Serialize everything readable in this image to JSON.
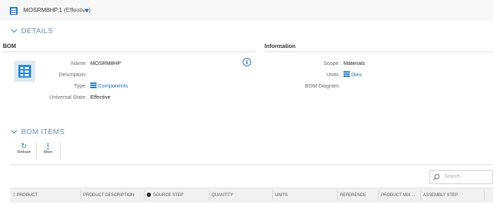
{
  "header": {
    "title": "MOSRM8HP.1",
    "state": "(Effective)",
    "icon": "bom-grid-icon"
  },
  "details": {
    "section_title": "DETAILS",
    "bom_heading": "BOM",
    "info_heading": "Information",
    "fields": {
      "name_label": "Name:",
      "name_value": "MOSRM8HP",
      "description_label": "Description:",
      "description_value": "",
      "type_label": "Type:",
      "type_value": "Components",
      "universal_state_label": "Universal State:",
      "universal_state_value": "Effective",
      "scope_label": "Scope:",
      "scope_value": "Materials",
      "units_label": "Units:",
      "units_value": "Dies",
      "bom_diagram_label": "BOM Diagram:",
      "bom_diagram_value": ""
    }
  },
  "bom_items": {
    "section_title": "BOM ITEMS",
    "toolbar": {
      "refresh_label": "Refresh",
      "more_label": "More"
    },
    "search_placeholder": "Search",
    "columns": [
      "PRODUCT",
      "PRODUCT DESCRIPTION",
      "SOURCE STEP",
      "QUANTITY",
      "UNITS",
      "REFERENCE",
      "PRODUCT MIX ...",
      "ASSEMBLY STEP"
    ]
  },
  "colors": {
    "accent": "#1976d2",
    "section_title": "#6b8fb3",
    "link": "#1f6fb8"
  }
}
